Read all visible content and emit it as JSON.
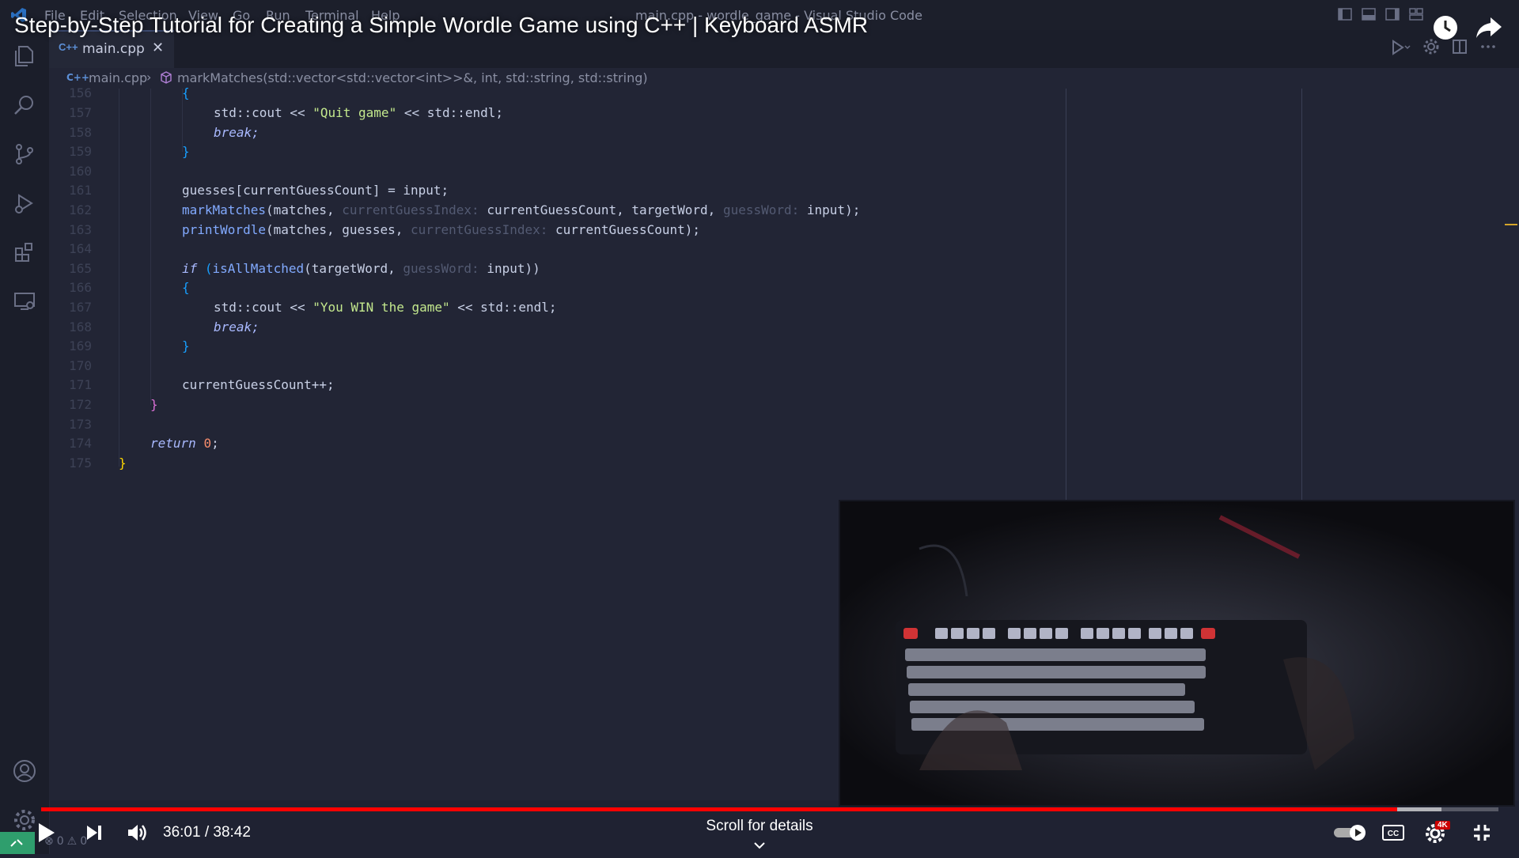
{
  "window": {
    "title": "main.cpp - wordle_game - Visual Studio Code",
    "menu": [
      "File",
      "Edit",
      "Selection",
      "View",
      "Go",
      "Run",
      "Terminal",
      "Help"
    ]
  },
  "video": {
    "title": "Step-by-Step Tutorial for Creating a Simple Wordle Game using C++ | Keyboard ASMR",
    "current_time": "36:01",
    "duration": "38:42",
    "time_display": "36:01 / 38:42",
    "progress": 0.9307,
    "scroll_hint": "Scroll for details",
    "quality_badge": "4K"
  },
  "tab": {
    "name": "main.cpp",
    "close": "✕"
  },
  "breadcrumb": {
    "file": "main.cpp",
    "symbol": "markMatches(std::vector<std::vector<int>>&, int, std::string, std::string)"
  },
  "code": {
    "line_numbers": [
      "156",
      "157",
      "158",
      "159",
      "160",
      "161",
      "162",
      "163",
      "164",
      "165",
      "166",
      "167",
      "168",
      "169",
      "170",
      "171",
      "172",
      "173",
      "174",
      "175"
    ],
    "l156": "{",
    "l157_a": "std::cout << ",
    "l157_s": "\"Quit game\"",
    "l157_b": " << std::endl;",
    "l158": "break;",
    "l159": "}",
    "l161": "guesses[currentGuessCount] = input;",
    "l162_fn": "markMatches",
    "l162_a": "(matches, ",
    "l162_h1": "currentGuessIndex:",
    "l162_b": " currentGuessCount, targetWord, ",
    "l162_h2": "guessWord:",
    "l162_c": " input);",
    "l163_fn": "printWordle",
    "l163_a": "(matches, guesses, ",
    "l163_h1": "currentGuessIndex:",
    "l163_b": " currentGuessCount);",
    "l165_k": "if",
    "l165_a": " (",
    "l165_fn": "isAllMatched",
    "l165_b": "(targetWord, ",
    "l165_h": "guessWord:",
    "l165_c": " input))",
    "l166": "{",
    "l167_a": "std::cout << ",
    "l167_s": "\"You WIN the game\"",
    "l167_b": " << std::endl;",
    "l168": "break;",
    "l169": "}",
    "l171": "currentGuessCount++;",
    "l172": "}",
    "l174_k": "return",
    "l174_n": "0",
    "l174_e": ";",
    "l175": "}"
  },
  "status": {
    "errors": "0",
    "warnings": "0"
  },
  "colors": {
    "editor_bg": "#222535",
    "progress": "#ff0000",
    "keyword": "#a9b9ff",
    "string": "#c3e88d"
  }
}
